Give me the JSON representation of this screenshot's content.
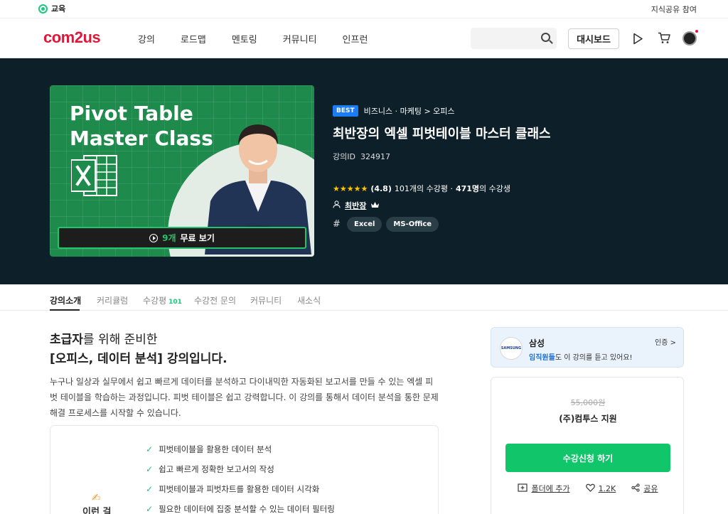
{
  "topbar": {
    "edu_label": "교육",
    "share_label": "지식공유 참여"
  },
  "nav": {
    "logo": "com2us",
    "menu": [
      "강의",
      "로드맵",
      "멘토링",
      "커뮤니티",
      "인프런"
    ],
    "search_placeholder": "",
    "dashboard_label": "대시보드"
  },
  "hero": {
    "thumb_title_line1": "Pivot Table",
    "thumb_title_line2": "Master Class",
    "free_count": "9개",
    "free_label": "무료 보기",
    "best_badge": "BEST",
    "category": "비즈니스 · 마케팅 > 오피스",
    "title": "최반장의 엑셀 피벗테이블 마스터 클래스",
    "course_id_label": "강의ID",
    "course_id": "324917",
    "stars": "★★★★★",
    "rating": "(4.8)",
    "review_count": "101개의 수강평 ·",
    "students": "471명",
    "students_suffix": "의 수강생",
    "instructor": "최반장",
    "tags": [
      "Excel",
      "MS-Office"
    ]
  },
  "tabs": [
    {
      "label": "강의소개"
    },
    {
      "label": "커리큘럼"
    },
    {
      "label": "수강평",
      "count": "101"
    },
    {
      "label": "수강전 문의"
    },
    {
      "label": "커뮤니티"
    },
    {
      "label": "새소식"
    }
  ],
  "content": {
    "headline1_bold": "초급자",
    "headline1_rest": "를 위해 준비한",
    "headline2": "[오피스, 데이터 분석] 강의입니다.",
    "description": "누구나 일상과 실무에서 쉽고 빠르게 데이터를 분석하고 다이내믹한 자동화된 보고서를 만들 수 있는 엑셀 피벗 테이블을 학습하는 과정입니다. 피벗 테이블은 쉽고 강력합니다. 이 강의를 통해서 데이터 분석을 통한 문제 해결 프로세스를 시작할 수 있습니다.",
    "side_label": "이런 걸",
    "points": [
      "피벗테이블을 활용한 데이터 분석",
      "쉽고 빠르게 정확한 보고서의 작성",
      "피벗테이블과 피벗차트를 활용한 데이터 시각화",
      "필요한 데이터에 집중 분석할 수 있는 데이터 필터링"
    ]
  },
  "sidebar": {
    "company_logo_text": "SAMSUNG",
    "company": "삼성",
    "verify_label": "인증 >",
    "company_desc_em": "임직원들",
    "company_desc_rest": "도 이 강의를 듣고 있어요!",
    "old_price": "55,000원",
    "support": "(주)컴투스 지원",
    "enroll_label": "수강신청 하기",
    "folder_label": "폴더에 추가",
    "likes": "1.2K",
    "share_label": "공유"
  }
}
